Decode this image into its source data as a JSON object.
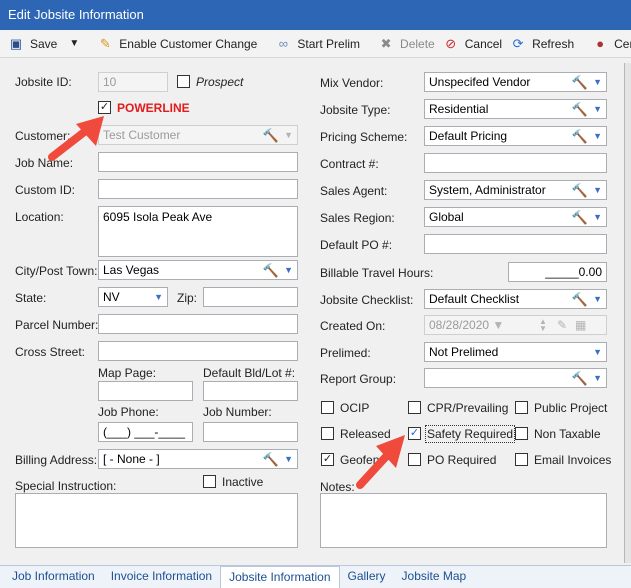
{
  "window": {
    "title": "Edit Jobsite Information"
  },
  "toolbar": {
    "save": "Save",
    "enable_customer_change": "Enable Customer Change",
    "start_prelim": "Start Prelim",
    "delete": "Delete",
    "cancel": "Cancel",
    "refresh": "Refresh",
    "certi": "Certi"
  },
  "left": {
    "jobsite_id_label": "Jobsite ID:",
    "jobsite_id_value": "10",
    "prospect_label": "Prospect",
    "powerline_label": "POWERLINE",
    "customer_label": "Customer:",
    "customer_value": "Test Customer",
    "job_name_label": "Job Name:",
    "job_name_value": "",
    "custom_id_label": "Custom ID:",
    "custom_id_value": "",
    "location_label": "Location:",
    "location_value": "6095 Isola Peak Ave",
    "city_label": "City/Post Town:",
    "city_value": "Las Vegas",
    "state_label": "State:",
    "state_value": "NV",
    "zip_label": "Zip:",
    "zip_value": "",
    "parcel_label": "Parcel Number:",
    "parcel_value": "",
    "cross_street_label": "Cross Street:",
    "cross_street_value": "",
    "map_page_label": "Map Page:",
    "map_page_value": "",
    "default_bld_label": "Default Bld/Lot #:",
    "default_bld_value": "",
    "job_phone_label": "Job Phone:",
    "job_phone_value": "(___) ___-____",
    "job_number_label": "Job Number:",
    "job_number_value": "",
    "billing_address_label": "Billing Address:",
    "billing_address_value": "[ - None - ]",
    "special_instruction_label": "Special Instruction:",
    "inactive_label": "Inactive",
    "special_instruction_value": ""
  },
  "right": {
    "mix_vendor_label": "Mix Vendor:",
    "mix_vendor_value": "Unspecifed Vendor",
    "jobsite_type_label": "Jobsite Type:",
    "jobsite_type_value": "Residential",
    "pricing_scheme_label": "Pricing Scheme:",
    "pricing_scheme_value": "Default Pricing",
    "contract_label": "Contract #:",
    "contract_value": "",
    "sales_agent_label": "Sales Agent:",
    "sales_agent_value": "System, Administrator",
    "sales_region_label": "Sales Region:",
    "sales_region_value": "Global",
    "default_po_label": "Default PO #:",
    "default_po_value": "",
    "billable_travel_label": "Billable Travel Hours:",
    "billable_travel_value": "_____0.00",
    "jobsite_checklist_label": "Jobsite Checklist:",
    "jobsite_checklist_value": "Default Checklist",
    "created_on_label": "Created On:",
    "created_on_value": "08/28/2020",
    "prelimed_label": "Prelimed:",
    "prelimed_value": "Not Prelimed",
    "report_group_label": "Report Group:",
    "report_group_value": "",
    "ocip_label": "OCIP",
    "cpr_label": "CPR/Prevailing",
    "public_project_label": "Public Project",
    "released_label": "Released",
    "safety_required_label": "Safety Required",
    "non_taxable_label": "Non Taxable",
    "geofence_label": "Geofen",
    "po_required_label": "PO Required",
    "email_invoices_label": "Email Invoices",
    "notes_label": "Notes:",
    "notes_value": ""
  },
  "tabs": [
    {
      "label": "Job Information"
    },
    {
      "label": "Invoice Information"
    },
    {
      "label": "Jobsite Information"
    },
    {
      "label": "Gallery"
    },
    {
      "label": "Jobsite Map"
    }
  ],
  "colors": {
    "title_bar": "#2d66b5",
    "powerline": "#e21b1b",
    "annotation_arrow": "#ef4a3c"
  }
}
